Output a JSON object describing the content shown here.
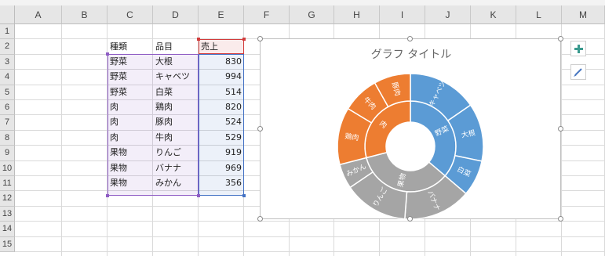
{
  "columns": [
    "A",
    "B",
    "C",
    "D",
    "E",
    "F",
    "G",
    "H",
    "I",
    "J",
    "K",
    "L",
    "M"
  ],
  "rows": [
    "1",
    "2",
    "3",
    "4",
    "5",
    "6",
    "7",
    "8",
    "9",
    "10",
    "11",
    "12",
    "13",
    "14",
    "15"
  ],
  "table": {
    "headers": [
      "種類",
      "品目",
      "売上"
    ],
    "rows": [
      [
        "野菜",
        "大根",
        "830"
      ],
      [
        "野菜",
        "キャベツ",
        "994"
      ],
      [
        "野菜",
        "白菜",
        "514"
      ],
      [
        "肉",
        "鶏肉",
        "820"
      ],
      [
        "肉",
        "豚肉",
        "524"
      ],
      [
        "肉",
        "牛肉",
        "529"
      ],
      [
        "果物",
        "りんご",
        "919"
      ],
      [
        "果物",
        "バナナ",
        "969"
      ],
      [
        "果物",
        "みかん",
        "356"
      ]
    ]
  },
  "chart": {
    "title": "グラフ タイトル",
    "add_element_icon": "plus-icon",
    "style_icon": "brush-icon"
  },
  "chart_data": {
    "type": "sunburst",
    "title": "グラフ タイトル",
    "groups": [
      {
        "name": "野菜",
        "color": "#5b9bd5",
        "items": [
          {
            "name": "キャベツ",
            "value": 994
          },
          {
            "name": "大根",
            "value": 830
          },
          {
            "name": "白菜",
            "value": 514
          }
        ]
      },
      {
        "name": "果物",
        "color": "#a5a5a5",
        "items": [
          {
            "name": "バナナ",
            "value": 969
          },
          {
            "name": "りんご",
            "value": 919
          },
          {
            "name": "みかん",
            "value": 356
          }
        ]
      },
      {
        "name": "肉",
        "color": "#ed7d31",
        "items": [
          {
            "name": "鶏肉",
            "value": 820
          },
          {
            "name": "牛肉",
            "value": 529
          },
          {
            "name": "豚肉",
            "value": 524
          }
        ]
      }
    ]
  }
}
